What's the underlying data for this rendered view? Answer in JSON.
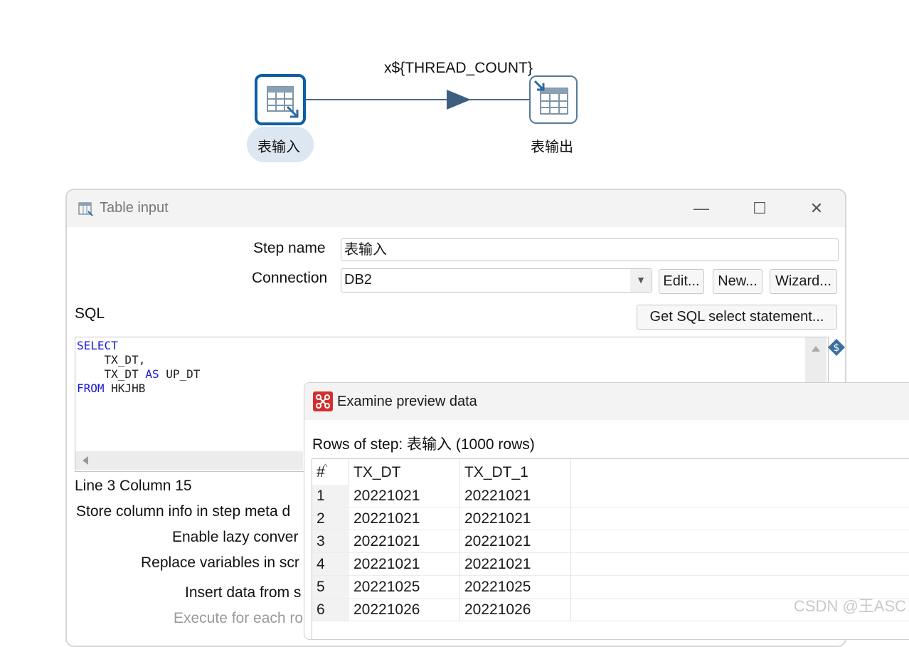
{
  "canvas": {
    "hop_label": "x${THREAD_COUNT}",
    "steps": [
      {
        "label": "表输入",
        "icon": "table-input-icon"
      },
      {
        "label": "表输出",
        "icon": "table-output-icon"
      }
    ]
  },
  "dialog": {
    "title": "Table input",
    "icon": "table-input-icon",
    "window_buttons": {
      "minimize": "—",
      "maximize": "☐",
      "close": "✕"
    },
    "step_name_label": "Step name",
    "step_name_value": "表输入",
    "connection_label": "Connection",
    "connection_value": "DB2",
    "buttons": {
      "edit": "Edit...",
      "new": "New...",
      "wizard": "Wizard...",
      "get_sql": "Get SQL select statement..."
    },
    "sql_label": "SQL",
    "sql_lines": [
      {
        "kw": "SELECT",
        "rest": ""
      },
      {
        "kw": "",
        "rest": "    TX_DT,"
      },
      {
        "kw": "",
        "rest": "    TX_DT ",
        "kw2": "AS",
        "rest2": " UP_DT"
      },
      {
        "kw": "FROM",
        "rest": " HKJHB"
      }
    ],
    "cursor_status": "Line 3 Column 15",
    "options": [
      "Store column info in step meta d",
      "Enable lazy conver",
      "Replace variables in scr",
      "Insert data from s",
      "Execute for each ro"
    ]
  },
  "preview": {
    "title": "Examine preview data",
    "rows_label": "Rows of step: 表输入 (1000 rows)",
    "columns": [
      "#",
      "TX_DT",
      "TX_DT_1"
    ],
    "rows": [
      [
        "1",
        "20221021",
        "20221021"
      ],
      [
        "2",
        "20221021",
        "20221021"
      ],
      [
        "3",
        "20221021",
        "20221021"
      ],
      [
        "4",
        "20221021",
        "20221021"
      ],
      [
        "5",
        "20221025",
        "20221025"
      ],
      [
        "6",
        "20221026",
        "20221026"
      ]
    ]
  },
  "watermark": "CSDN @王ASC",
  "colors": {
    "selected_border": "#0b5ea8",
    "keyword": "#1a1ad6",
    "hop": "#3c5f80"
  }
}
